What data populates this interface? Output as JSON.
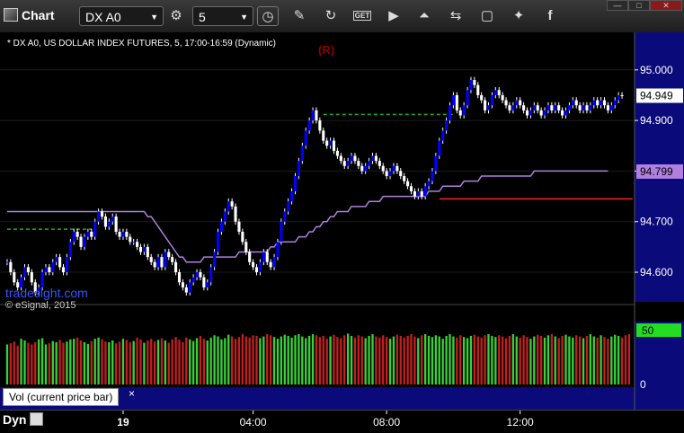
{
  "toolbar": {
    "app_label": "Chart",
    "symbol_value": "DX A0",
    "interval_value": "5",
    "icons": [
      "pen-icon",
      "refresh-icon",
      "get-icon",
      "play-icon",
      "alert-icon",
      "link-icon",
      "comment-icon",
      "twitter-icon",
      "facebook-icon"
    ],
    "get_label": "GET"
  },
  "window": {
    "minimize": "—",
    "maximize": "□",
    "close": "✕"
  },
  "chart_header": {
    "description": "* DX A0, US DOLLAR INDEX FUTURES, 5, 17:00-16:59 (Dynamic)",
    "marker": "(R)",
    "watermark": "tradesight.com",
    "copyright": "© eSignal, 2015"
  },
  "vol_panel": {
    "label": "Vol (current price bar)",
    "close": "×"
  },
  "footer": {
    "mode_label": "Dyn"
  },
  "colors": {
    "up": "#0000ff",
    "down": "#ffffff",
    "ma": "#b080e0",
    "green": "#22aa22",
    "red": "#ff2020",
    "counter": "#ff33ff",
    "axis_bg": "#0a0a7a",
    "price_tag": "#ffffff"
  },
  "chart_data": {
    "type": "candlestick",
    "symbol": "DX A0",
    "ylim": [
      94.545,
      95.06
    ],
    "y_ticks": [
      94.6,
      94.7,
      94.8,
      94.9,
      95.0
    ],
    "y_tick_labels": [
      "94.600",
      "94.700",
      "94.800",
      "94.900",
      "95.000"
    ],
    "x_ticks": [
      {
        "label": "19",
        "bar": 33
      },
      {
        "label": "04:00",
        "bar": 70
      },
      {
        "label": "08:00",
        "bar": 108
      },
      {
        "label": "12:00",
        "bar": 146
      }
    ],
    "last_price": {
      "value": 94.949,
      "label": "94.949"
    },
    "ma_price": {
      "value": 94.799,
      "label": "94.799"
    },
    "ma_close": [
      94.72,
      94.72,
      94.72,
      94.72,
      94.72,
      94.72,
      94.72,
      94.72,
      94.72,
      94.72,
      94.72,
      94.72,
      94.72,
      94.72,
      94.72,
      94.72,
      94.72,
      94.72,
      94.72,
      94.72,
      94.72,
      94.72,
      94.72,
      94.72,
      94.72,
      94.72,
      94.72,
      94.72,
      94.72,
      94.72,
      94.72,
      94.72,
      94.72,
      94.72,
      94.72,
      94.72,
      94.72,
      94.72,
      94.72,
      94.72,
      94.71,
      94.71,
      94.7,
      94.69,
      94.68,
      94.67,
      94.66,
      94.65,
      94.64,
      94.63,
      94.63,
      94.62,
      94.62,
      94.62,
      94.62,
      94.62,
      94.63,
      94.63,
      94.63,
      94.63,
      94.63,
      94.63,
      94.63,
      94.63,
      94.63,
      94.63,
      94.64,
      94.64,
      94.64,
      94.64,
      94.64,
      94.64,
      94.64,
      94.64,
      94.64,
      94.65,
      94.65,
      94.66,
      94.66,
      94.66,
      94.66,
      94.66,
      94.66,
      94.67,
      94.67,
      94.67,
      94.68,
      94.68,
      94.69,
      94.69,
      94.7,
      94.7,
      94.71,
      94.71,
      94.72,
      94.72,
      94.72,
      94.72,
      94.73,
      94.73,
      94.73,
      94.73,
      94.73,
      94.74,
      94.74,
      94.74,
      94.74,
      94.75,
      94.75,
      94.75,
      94.75,
      94.75,
      94.75,
      94.75,
      94.75,
      94.75,
      94.75,
      94.75,
      94.75,
      94.75,
      94.76,
      94.76,
      94.76,
      94.76,
      94.77,
      94.77,
      94.77,
      94.77,
      94.77,
      94.77,
      94.78,
      94.78,
      94.78,
      94.78,
      94.78,
      94.79,
      94.79,
      94.79,
      94.79,
      94.79,
      94.79,
      94.79,
      94.79,
      94.79,
      94.79,
      94.79,
      94.79,
      94.79,
      94.79,
      94.79,
      94.8,
      94.8,
      94.8,
      94.8,
      94.8,
      94.8,
      94.8,
      94.8,
      94.8,
      94.8,
      94.8,
      94.8,
      94.8,
      94.8,
      94.8,
      94.8,
      94.8,
      94.8,
      94.8,
      94.8,
      94.8,
      94.8
    ],
    "close": [
      94.62,
      94.6,
      94.58,
      94.57,
      94.59,
      94.61,
      94.6,
      94.58,
      94.56,
      94.57,
      94.6,
      94.61,
      94.6,
      94.62,
      94.63,
      94.61,
      94.6,
      94.63,
      94.66,
      94.68,
      94.67,
      94.65,
      94.67,
      94.68,
      94.67,
      94.7,
      94.72,
      94.71,
      94.69,
      94.7,
      94.71,
      94.68,
      94.67,
      94.68,
      94.67,
      94.66,
      94.66,
      94.65,
      94.64,
      94.65,
      94.63,
      94.62,
      94.61,
      94.63,
      94.61,
      94.64,
      94.63,
      94.62,
      94.6,
      94.58,
      94.57,
      94.56,
      94.58,
      94.59,
      94.6,
      94.59,
      94.57,
      94.58,
      94.61,
      94.64,
      94.68,
      94.7,
      94.72,
      94.74,
      94.73,
      94.7,
      94.68,
      94.66,
      94.64,
      94.62,
      94.61,
      94.6,
      94.62,
      94.64,
      94.62,
      94.61,
      94.63,
      94.66,
      94.7,
      94.72,
      94.74,
      94.76,
      94.79,
      94.82,
      94.85,
      94.88,
      94.9,
      94.92,
      94.9,
      94.88,
      94.86,
      94.85,
      94.86,
      94.84,
      94.83,
      94.82,
      94.81,
      94.82,
      94.83,
      94.82,
      94.81,
      94.8,
      94.81,
      94.82,
      94.83,
      94.82,
      94.81,
      94.8,
      94.79,
      94.8,
      94.81,
      94.8,
      94.79,
      94.78,
      94.77,
      94.76,
      94.75,
      94.76,
      94.75,
      94.77,
      94.78,
      94.8,
      94.83,
      94.86,
      94.88,
      94.9,
      94.93,
      94.95,
      94.92,
      94.91,
      94.93,
      94.96,
      94.98,
      94.97,
      94.95,
      94.94,
      94.92,
      94.93,
      94.95,
      94.96,
      94.95,
      94.94,
      94.93,
      94.92,
      94.93,
      94.94,
      94.93,
      94.92,
      94.91,
      94.92,
      94.93,
      94.92,
      94.91,
      94.92,
      94.93,
      94.92,
      94.93,
      94.92,
      94.91,
      94.92,
      94.93,
      94.94,
      94.93,
      94.92,
      94.93,
      94.92,
      94.93,
      94.94,
      94.93,
      94.94,
      94.93,
      94.92,
      94.93,
      94.94,
      94.95,
      94.949
    ],
    "green_dashed_levels": [
      {
        "value": 94.685,
        "from_bar": 0,
        "to_bar": 24
      },
      {
        "value": 94.912,
        "from_bar": 90,
        "to_bar": 127
      }
    ],
    "red_level": {
      "value": 94.745,
      "from_bar": 123,
      "to_bar": 178
    },
    "volume": {
      "ylim": [
        0,
        110
      ],
      "y_ticks": [
        0
      ],
      "y_tick_labels": [
        "0"
      ],
      "current_label": "50",
      "values": [
        70,
        72,
        75,
        68,
        80,
        77,
        73,
        70,
        74,
        79,
        81,
        70,
        72,
        76,
        74,
        78,
        73,
        75,
        79,
        80,
        82,
        77,
        74,
        71,
        76,
        80,
        82,
        79,
        75,
        74,
        77,
        72,
        75,
        80,
        78,
        74,
        76,
        82,
        79,
        73,
        77,
        80,
        75,
        78,
        81,
        77,
        73,
        79,
        83,
        78,
        74,
        82,
        79,
        76,
        81,
        85,
        80,
        77,
        82,
        86,
        84,
        79,
        81,
        87,
        84,
        80,
        83,
        88,
        84,
        82,
        86,
        85,
        81,
        84,
        88,
        86,
        83,
        80,
        84,
        87,
        85,
        82,
        86,
        88,
        84,
        81,
        85,
        88,
        86,
        83,
        85,
        80,
        84,
        87,
        83,
        81,
        86,
        89,
        85,
        82,
        86,
        84,
        81,
        85,
        88,
        84,
        82,
        86,
        83,
        80,
        84,
        87,
        85,
        82,
        85,
        88,
        84,
        81,
        86,
        88,
        85,
        83,
        86,
        84,
        80,
        85,
        88,
        84,
        82,
        86,
        83,
        81,
        85,
        87,
        84,
        82,
        86,
        88,
        85,
        83,
        86,
        84,
        81,
        85,
        88,
        84,
        82,
        86,
        83,
        80,
        84,
        87,
        85,
        82,
        86,
        88,
        84,
        81,
        85,
        87,
        84,
        82,
        86,
        84,
        81,
        85,
        88,
        84,
        82,
        86,
        83,
        80,
        84,
        87,
        85,
        82,
        86,
        88
      ]
    }
  }
}
